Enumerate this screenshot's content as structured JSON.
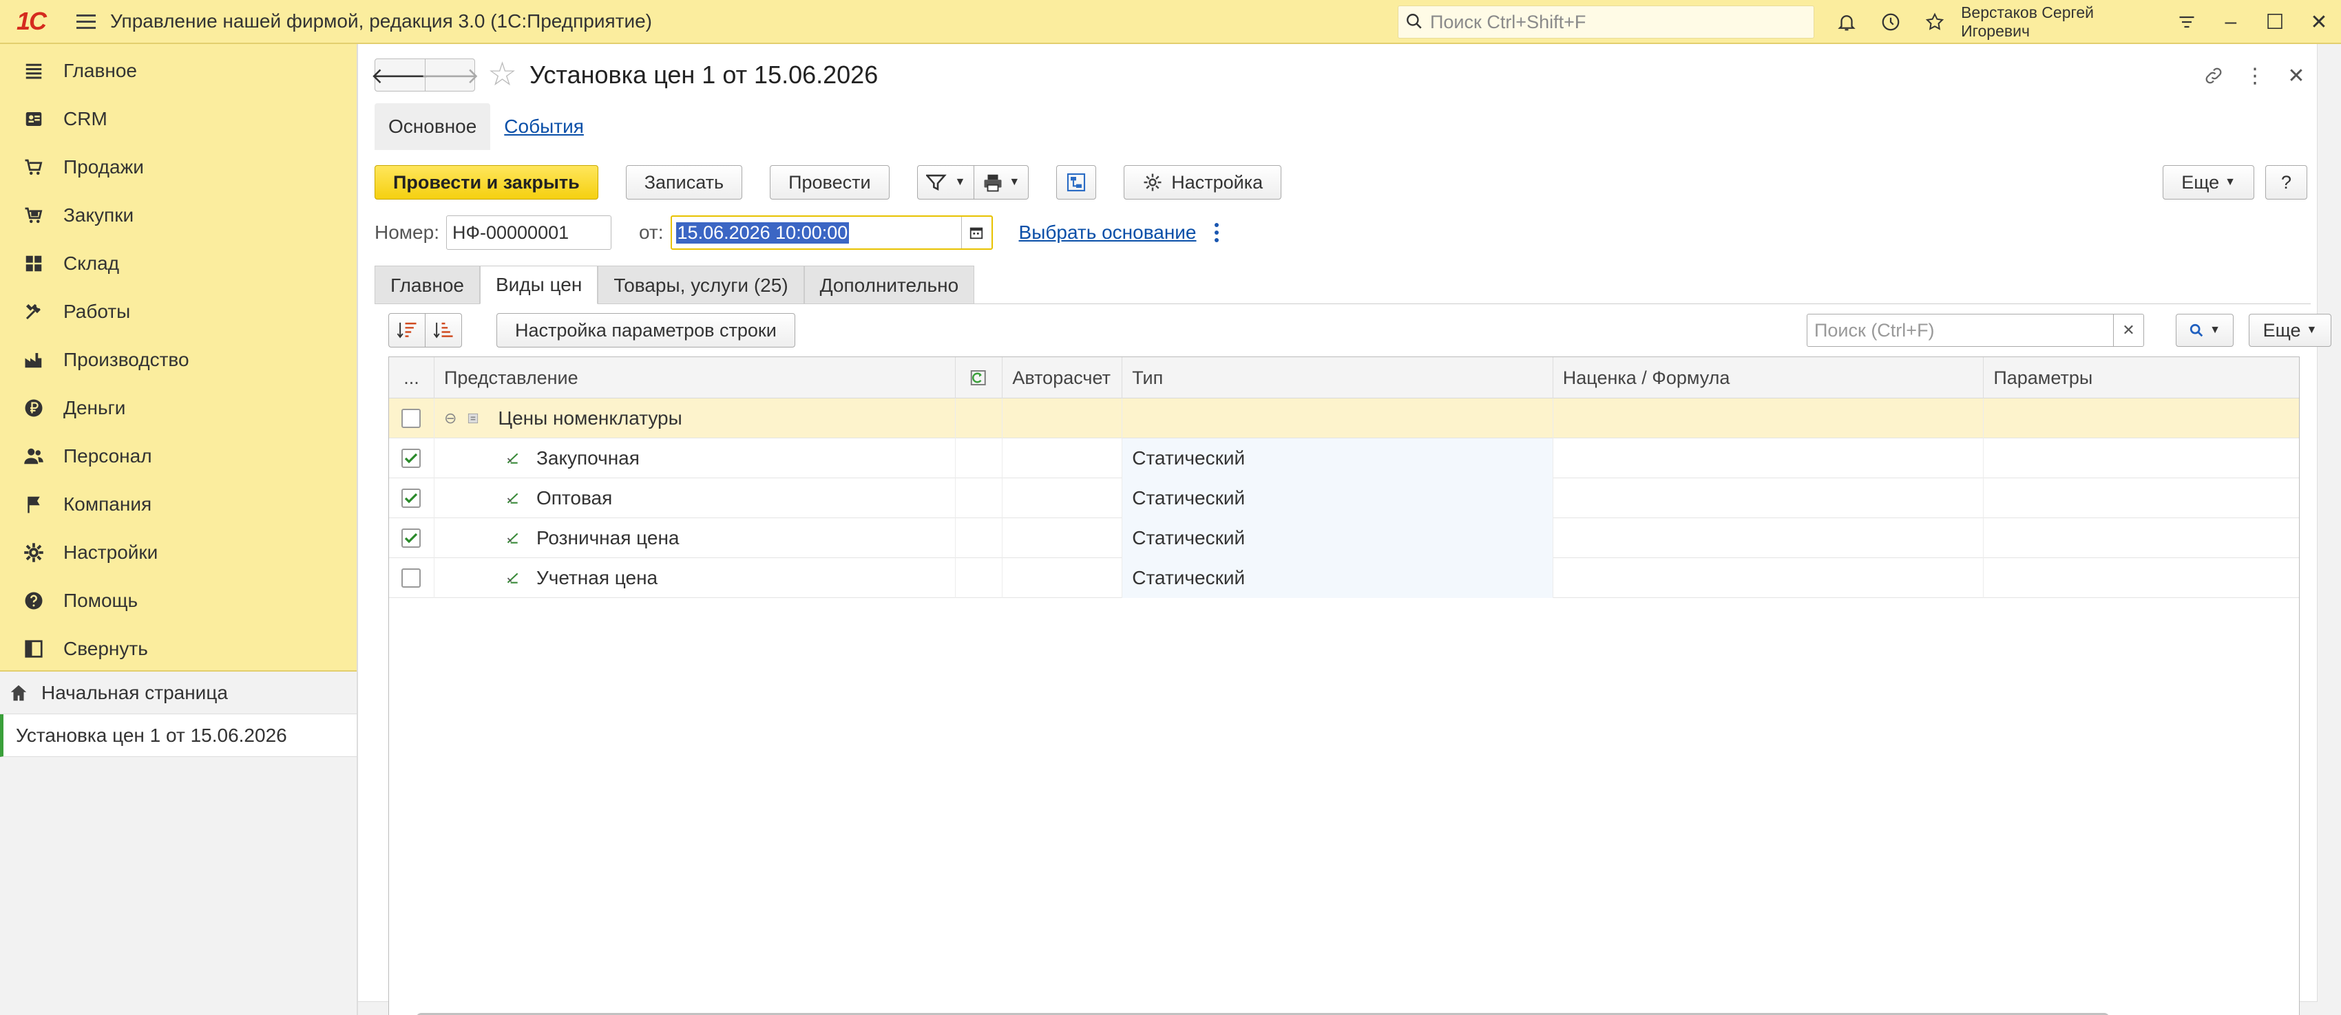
{
  "app": {
    "title": "Управление нашей фирмой, редакция 3.0  (1С:Предприятие)",
    "logo_text": "1С",
    "search_placeholder": "Поиск Ctrl+Shift+F",
    "user": "Верстаков Сергей Игоревич"
  },
  "sidebar": {
    "items": [
      {
        "label": "Главное",
        "icon": "menu-lines-icon"
      },
      {
        "label": "CRM",
        "icon": "contacts-icon"
      },
      {
        "label": "Продажи",
        "icon": "cart-icon"
      },
      {
        "label": "Закупки",
        "icon": "purchase-icon"
      },
      {
        "label": "Склад",
        "icon": "warehouse-icon"
      },
      {
        "label": "Работы",
        "icon": "tools-icon"
      },
      {
        "label": "Производство",
        "icon": "factory-icon"
      },
      {
        "label": "Деньги",
        "icon": "ruble-icon"
      },
      {
        "label": "Персонал",
        "icon": "people-icon"
      },
      {
        "label": "Компания",
        "icon": "flag-icon"
      },
      {
        "label": "Настройки",
        "icon": "gear-icon"
      },
      {
        "label": "Помощь",
        "icon": "help-icon"
      },
      {
        "label": "Свернуть",
        "icon": "collapse-icon"
      }
    ],
    "open_windows": {
      "home": "Начальная страница",
      "current": "Установка цен 1 от 15.06.2026"
    }
  },
  "document": {
    "title": "Установка цен 1 от 15.06.2026",
    "form_tabs": {
      "main": "Основное",
      "events": "События"
    },
    "toolbar": {
      "post_close": "Провести и закрыть",
      "save": "Записать",
      "post": "Провести",
      "settings": "Настройка",
      "more": "Еще",
      "help": "?"
    },
    "number_label": "Номер:",
    "number_value": "НФ-00000001",
    "date_label": "от:",
    "date_value": "15.06.2026 10:00:00",
    "basis_link": "Выбрать основание",
    "tabs": [
      "Главное",
      "Виды цен",
      "Товары, услуги (25)",
      "Дополнительно"
    ],
    "grid_toolbar": {
      "row_settings": "Настройка параметров строки",
      "search_placeholder": "Поиск (Ctrl+F)",
      "more": "Еще"
    },
    "grid": {
      "columns": [
        "...",
        "Представление",
        "",
        "Авторасчет",
        "Тип",
        "Наценка / Формула",
        "Параметры"
      ],
      "group": {
        "label": "Цены номенклатуры",
        "checked": false
      },
      "rows": [
        {
          "name": "Закупочная",
          "type": "Статический",
          "checked": true
        },
        {
          "name": "Оптовая",
          "type": "Статический",
          "checked": true
        },
        {
          "name": "Розничная цена",
          "type": "Статический",
          "checked": true
        },
        {
          "name": "Учетная цена",
          "type": "Статический",
          "checked": false
        }
      ]
    }
  },
  "colors": {
    "topbar": "#fbed9e",
    "primary_button": "#f5d010",
    "link": "#0a4fa8",
    "accent_active": "#3aa03a"
  }
}
